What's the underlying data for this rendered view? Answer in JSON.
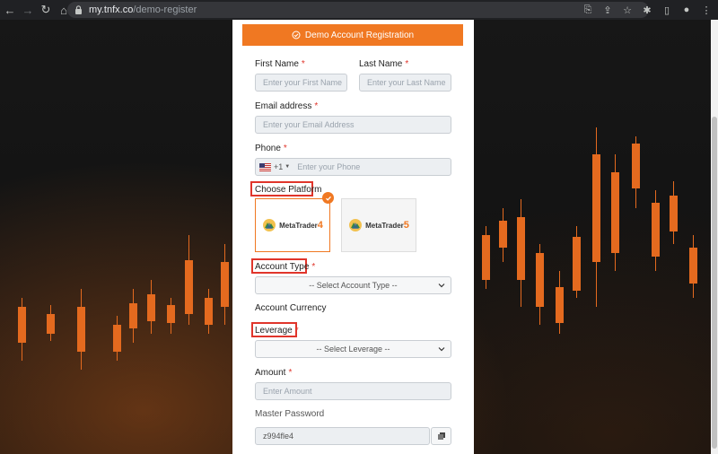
{
  "browser": {
    "url_host": "my.tnfx.co",
    "url_path": "/demo-register"
  },
  "form": {
    "title": "Demo Account Registration",
    "first_name": {
      "label": "First Name",
      "required": "*",
      "placeholder": "Enter your First Name"
    },
    "last_name": {
      "label": "Last Name",
      "required": "*",
      "placeholder": "Enter your Last Name"
    },
    "email": {
      "label": "Email address",
      "required": "*",
      "placeholder": "Enter your Email Address"
    },
    "phone": {
      "label": "Phone",
      "required": "*",
      "country_code": "+1",
      "placeholder": "Enter your Phone"
    },
    "platform": {
      "label": "Choose Platform",
      "options": [
        {
          "name": "MetaTrader",
          "version": "4",
          "selected": true
        },
        {
          "name": "MetaTrader",
          "version": "5",
          "selected": false
        }
      ]
    },
    "account_type": {
      "label": "Account Type",
      "required": "*",
      "selected": "-- Select Account Type --"
    },
    "account_currency": {
      "label": "Account Currency"
    },
    "leverage": {
      "label": "Leverage",
      "required": "*",
      "selected": "-- Select Leverage --"
    },
    "amount": {
      "label": "Amount",
      "required": "*",
      "placeholder": "Enter Amount"
    },
    "master_password": {
      "label": "Master Password",
      "value": "z994fle4"
    }
  },
  "colors": {
    "accent": "#f07822",
    "highlight": "#e0352b",
    "chrome": "#202124"
  }
}
